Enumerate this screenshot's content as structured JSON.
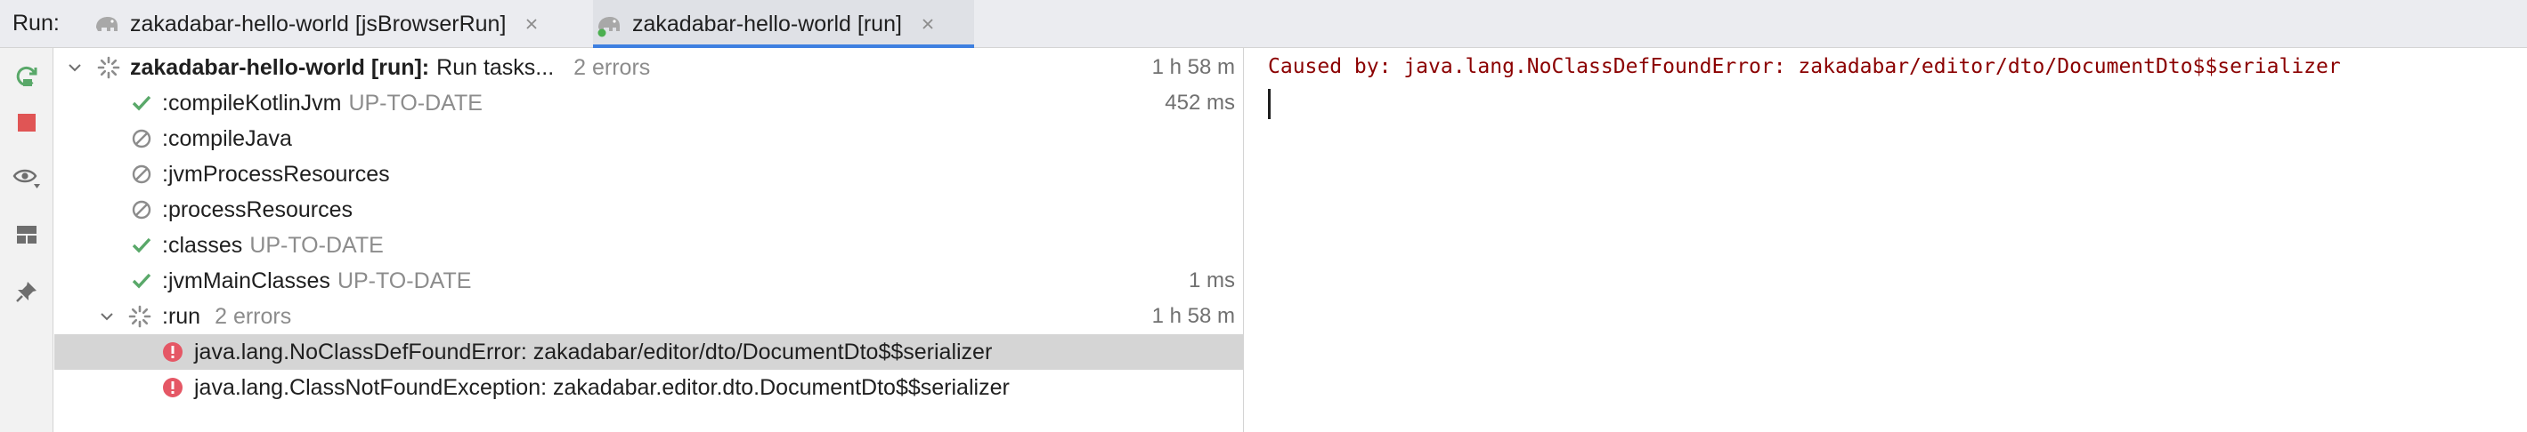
{
  "run_label": "Run:",
  "tabs": [
    {
      "label": "zakadabar-hello-world [jsBrowserRun]",
      "active": false,
      "icon": "gradle-elephant-icon"
    },
    {
      "label": "zakadabar-hello-world [run]",
      "active": true,
      "icon": "gradle-elephant-running-icon"
    }
  ],
  "toolbar": [
    {
      "name": "rerun-icon"
    },
    {
      "name": "stop-icon"
    },
    {
      "name": "view-options-icon"
    },
    {
      "name": "layout-icon"
    },
    {
      "name": "pin-icon"
    }
  ],
  "tree": {
    "root": {
      "name": "zakadabar-hello-world [run]:",
      "status": "Run tasks...",
      "errors": "2 errors",
      "time": "1 h 58 m"
    },
    "tasks": [
      {
        "name": ":compileKotlinJvm",
        "note": "UP-TO-DATE",
        "time": "452 ms",
        "status": "success"
      },
      {
        "name": ":compileJava",
        "note": "",
        "time": "",
        "status": "skipped"
      },
      {
        "name": ":jvmProcessResources",
        "note": "",
        "time": "",
        "status": "skipped"
      },
      {
        "name": ":processResources",
        "note": "",
        "time": "",
        "status": "skipped"
      },
      {
        "name": ":classes",
        "note": "UP-TO-DATE",
        "time": "",
        "status": "success"
      },
      {
        "name": ":jvmMainClasses",
        "note": "UP-TO-DATE",
        "time": "1 ms",
        "status": "success"
      },
      {
        "name": ":run",
        "note": "2 errors",
        "time": "1 h 58 m",
        "status": "running"
      }
    ],
    "errors": [
      {
        "text": "java.lang.NoClassDefFoundError: zakadabar/editor/dto/DocumentDto$$serializer",
        "selected": true
      },
      {
        "text": "java.lang.ClassNotFoundException: zakadabar.editor.dto.DocumentDto$$serializer",
        "selected": false
      }
    ]
  },
  "console": {
    "line": "Caused by: java.lang.NoClassDefFoundError: zakadabar/editor/dto/DocumentDto$$serializer"
  },
  "colors": {
    "success": "#59a869",
    "error": "#e55765",
    "accent": "#3d7fe0",
    "console_error": "#8b0000"
  }
}
